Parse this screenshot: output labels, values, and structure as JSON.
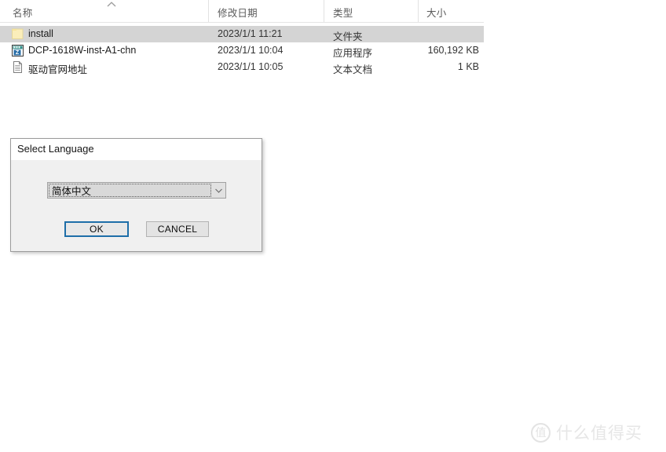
{
  "explorer": {
    "columns": [
      {
        "key": "name",
        "label": "名称"
      },
      {
        "key": "date",
        "label": "修改日期"
      },
      {
        "key": "type",
        "label": "类型"
      },
      {
        "key": "size",
        "label": "大小"
      }
    ],
    "sort_indicator_icon": "chevron-up-icon",
    "sort_column": "名称",
    "rows": [
      {
        "icon": "folder-icon",
        "name": "install",
        "date": "2023/1/1 11:21",
        "type": "文件夹",
        "size": "",
        "selected": true
      },
      {
        "icon": "application-icon",
        "name": "DCP-1618W-inst-A1-chn",
        "date": "2023/1/1 10:04",
        "type": "应用程序",
        "size": "160,192 KB",
        "selected": false
      },
      {
        "icon": "text-document-icon",
        "name": "驱动官网地址",
        "date": "2023/1/1 10:05",
        "type": "文本文档",
        "size": "1 KB",
        "selected": false
      }
    ],
    "colors": {
      "selection": "#d4d4d4",
      "header_text": "#5a5a5a",
      "divider": "#e5e5e5"
    }
  },
  "dialog": {
    "title": "Select Language",
    "language_select": {
      "value": "简体中文",
      "arrow_icon": "chevron-down-icon"
    },
    "ok_label": "OK",
    "cancel_label": "CANCEL",
    "colors": {
      "face": "#f0f0f0",
      "focus_border": "#1e6ea8",
      "border": "#9b9b9b"
    }
  },
  "watermark": {
    "badge_text": "值",
    "text": "什么值得买",
    "color": "#e6e6e6"
  }
}
